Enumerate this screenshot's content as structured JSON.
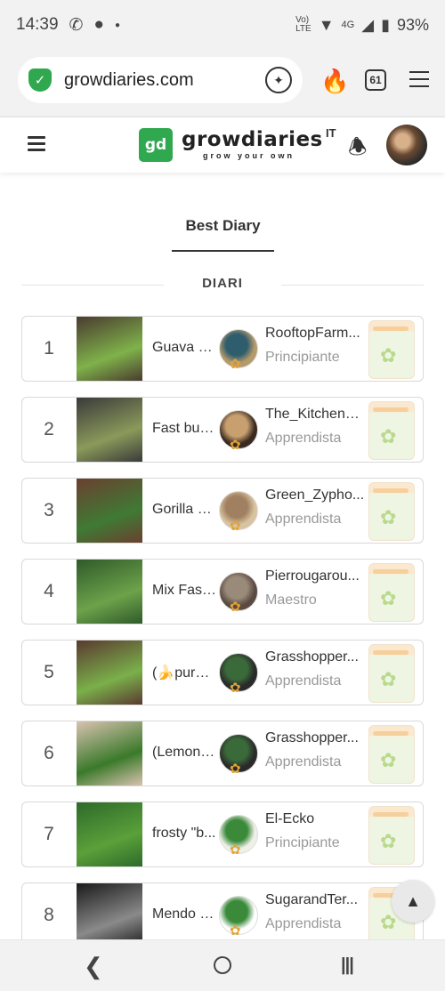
{
  "status_bar": {
    "time": "14:39",
    "battery": "93%",
    "network": "4G",
    "icons": [
      "whatsapp-icon",
      "chat-icon",
      "dot-icon",
      "volte-icon",
      "wifi-icon",
      "signal-icon",
      "battery-icon"
    ]
  },
  "browser": {
    "url": "growdiaries.com",
    "tab_count": "61",
    "icons": [
      "shield-icon",
      "assistant-icon",
      "flame-icon",
      "tabs-icon",
      "menu-icon"
    ]
  },
  "header": {
    "logo_mark": "gd",
    "logo_text": "growdiaries",
    "logo_tagline": "grow your own",
    "language": "IT"
  },
  "tabs": {
    "active": "Best Diary"
  },
  "section": {
    "title": "DIARI"
  },
  "diaries": [
    {
      "rank": "1",
      "name": "Guava S...",
      "user": "RooftopFarm...",
      "level": "Principiante",
      "thumb_colors": [
        "#4a3b30",
        "#7fb24a"
      ],
      "avatar_colors": [
        "#b69a6a",
        "#2e5d6e"
      ]
    },
    {
      "rank": "2",
      "name": "Fast bud...",
      "user": "The_Kitchen_...",
      "level": "Apprendista",
      "thumb_colors": [
        "#3a3a3a",
        "#8a9a5a"
      ],
      "avatar_colors": [
        "#3a2a20",
        "#c8a070"
      ]
    },
    {
      "rank": "3",
      "name": "Gorilla M...",
      "user": "Green_Zypho...",
      "level": "Apprendista",
      "thumb_colors": [
        "#6a4030",
        "#3f7a34"
      ],
      "avatar_colors": [
        "#d8c3a0",
        "#a08060"
      ]
    },
    {
      "rank": "4",
      "name": "Mix Fast ...",
      "user": "Pierrougarou...",
      "level": "Maestro",
      "thumb_colors": [
        "#2f5a2a",
        "#6da24a"
      ],
      "avatar_colors": [
        "#5a4a40",
        "#9a8a7a"
      ]
    },
    {
      "rank": "5",
      "name": "(🍌purpl...",
      "user": "Grasshopper...",
      "level": "Apprendista",
      "thumb_colors": [
        "#5a3a30",
        "#7ab04a"
      ],
      "avatar_colors": [
        "#2a2a2a",
        "#3a6a3a"
      ]
    },
    {
      "rank": "6",
      "name": "(Lemon ...",
      "user": "Grasshopper...",
      "level": "Apprendista",
      "thumb_colors": [
        "#d9c2b0",
        "#3a7a2a"
      ],
      "avatar_colors": [
        "#2a2a2a",
        "#3a6a3a"
      ]
    },
    {
      "rank": "7",
      "name": "frosty \"b...",
      "user": "El-Ecko",
      "level": "Principiante",
      "thumb_colors": [
        "#2e6a2a",
        "#5aa03a"
      ],
      "avatar_colors": [
        "#f0f0e8",
        "#3a8a3a"
      ]
    },
    {
      "rank": "8",
      "name": "Mendo F...",
      "user": "SugarandTer...",
      "level": "Apprendista",
      "thumb_colors": [
        "#1a1a1a",
        "#8a8a8a"
      ],
      "avatar_colors": [
        "#ffffff",
        "#3a8a3a"
      ]
    }
  ],
  "colors": {
    "brand_green": "#2fa84f",
    "level_gray": "#999999",
    "jar_lid": "#f6cf9c"
  }
}
